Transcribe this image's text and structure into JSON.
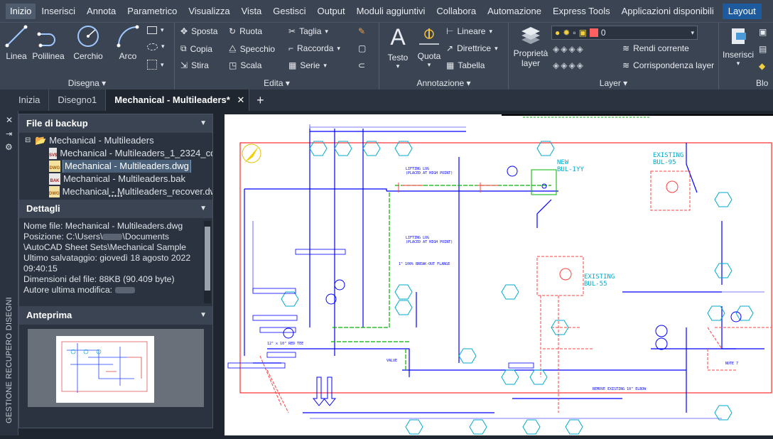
{
  "menubar": {
    "tabs": [
      "Inizio",
      "Inserisci",
      "Annota",
      "Parametrico",
      "Visualizza",
      "Vista",
      "Gestisci",
      "Output",
      "Moduli aggiuntivi",
      "Collabora",
      "Automazione",
      "Express Tools",
      "Applicazioni disponibili",
      "Layout"
    ],
    "active": "Inizio"
  },
  "ribbon": {
    "draw": {
      "title": "Disegna",
      "line": "Linea",
      "polyline": "Polilinea",
      "circle": "Cerchio",
      "arc": "Arco"
    },
    "edit": {
      "title": "Edita",
      "move": "Sposta",
      "rotate": "Ruota",
      "trim": "Taglia",
      "copy": "Copia",
      "mirror": "Specchio",
      "fillet": "Raccorda",
      "stretch": "Stira",
      "scale": "Scala",
      "array": "Serie"
    },
    "annotation": {
      "title": "Annotazione",
      "text": "Testo",
      "dimension": "Quota",
      "linear": "Lineare",
      "leader": "Direttrice",
      "table": "Tabella"
    },
    "layers": {
      "title": "Layer",
      "properties": "Proprietà layer",
      "layer_value": "0",
      "make_current": "Rendi corrente",
      "match": "Corrispondenza layer"
    },
    "insert": {
      "title": "Blo",
      "insert": "Inserisci"
    }
  },
  "doctabs": {
    "tabs": [
      "Inizia",
      "Disegno1",
      "Mechanical - Multileaders*"
    ],
    "active": "Mechanical - Multileaders*"
  },
  "sidebar": {
    "vertical_label": "GESTIONE RECUPERO DISEGNI"
  },
  "backup": {
    "title": "File di backup",
    "root": "Mechanical - Multileaders",
    "files": [
      {
        "name": "Mechanical - Multileaders_1_2324_cd0b",
        "badge": "SV$"
      },
      {
        "name": "Mechanical - Multileaders.dwg",
        "badge": "DWG",
        "selected": true
      },
      {
        "name": "Mechanical - Multileaders.bak",
        "badge": "BAK"
      },
      {
        "name": "Mechanical - Multileaders_recover.dwg",
        "badge": "DWG"
      }
    ]
  },
  "details": {
    "title": "Dettagli",
    "l1": "Nome file: Mechanical - Multileaders.dwg",
    "l2a": "Posizione: C:\\Users\\",
    "l2b": "\\Documents",
    "l3": "\\AutoCAD Sheet Sets\\Mechanical Sample",
    "l4": "Ultimo salvataggio: giovedì 18 agosto 2022",
    "l5": "09:40:15",
    "l6": "Dimensioni del file: 88KB (90.409 byte)",
    "l7": "Autore ultima modifica:"
  },
  "preview": {
    "title": "Anteprima"
  },
  "drawing": {
    "labels": {
      "new": "NEW",
      "new_bul": "BUL-IYY",
      "existing1": "EXISTING",
      "existing1_bul": "BUL-95",
      "existing2": "EXISTING",
      "existing2_bul": "BUL-55",
      "lifting": "LIFTING LUG",
      "lifting_sub": "(PLACED AT HIGH POINT)",
      "break": "1\" 100% BREAK-OUT FLANGE",
      "red_tee": "12\" x 10\" RED TEE",
      "valve": "VALVE",
      "remove": "REMOVE EXISTING 10\" ELBOW",
      "note": "NOTE 7"
    }
  },
  "colors": {
    "menubar": "#3b4453",
    "panel": "#2b3340",
    "accent": "#1d5a9e",
    "cad_blue": "#0000ff",
    "cad_red": "#ff0000",
    "cad_green": "#00b000",
    "cad_cyan": "#00aacc"
  }
}
